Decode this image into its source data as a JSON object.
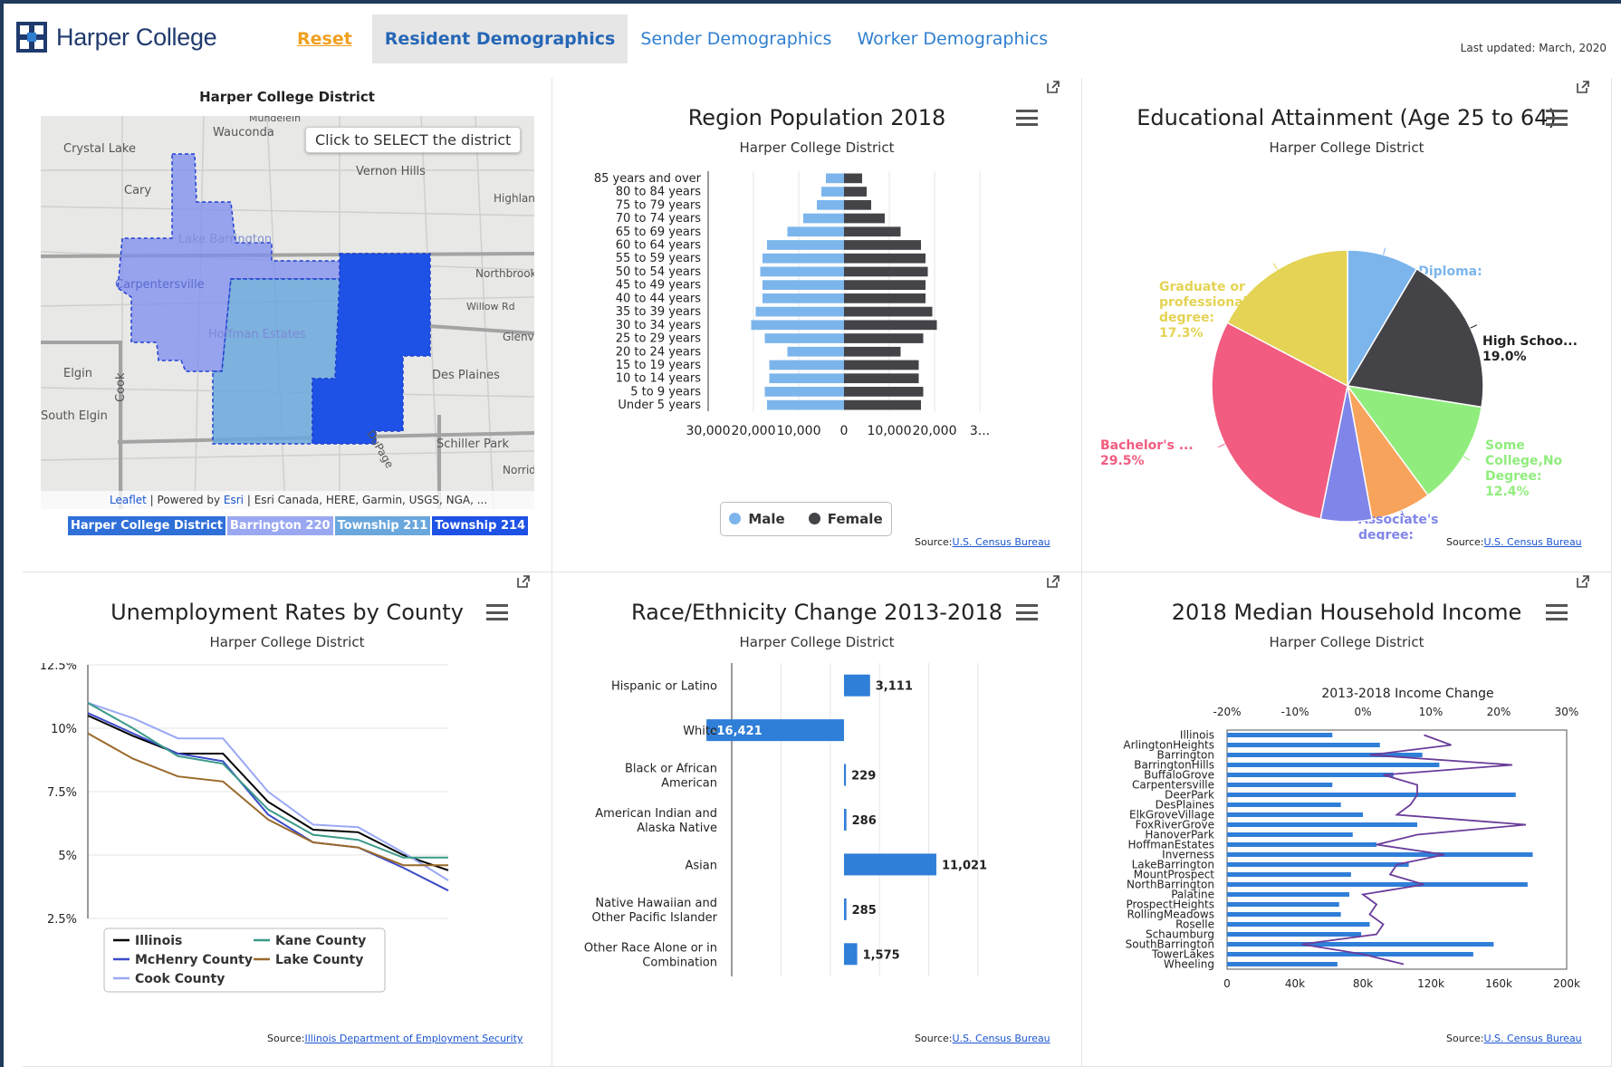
{
  "header": {
    "logo_text": "Harper College",
    "nav": {
      "reset": "Reset",
      "resident": "Resident Demographics",
      "sender": "Sender Demographics",
      "worker": "Worker Demographics"
    },
    "last_updated": "Last updated: March, 2020"
  },
  "map_panel": {
    "title": "Harper College District",
    "select_hint": "Click to SELECT the district",
    "place_labels": [
      "Wauconda",
      "Crystal Lake",
      "Vernon Hills",
      "Cary",
      "Highland Park",
      "Lake Barrington",
      "Carpentersville",
      "Northbrook",
      "Willow Rd",
      "Glenview",
      "Hoffman Estates",
      "Elgin",
      "Cook",
      "Des Plaines",
      "South Elgin",
      "Schiller Park",
      "DuPage",
      "Norridge",
      "Mundelein"
    ],
    "attribution": {
      "leaflet": "Leaflet",
      "powered": " | Powered by ",
      "esri": "Esri",
      "rest": " | Esri Canada, HERE, Garmin, USGS, NGA, ..."
    },
    "legend": [
      "Harper College District",
      "Barrington 220",
      "Township 211",
      "Township 214"
    ],
    "colors": {
      "district": "#7d8cf0",
      "barrington": "#9aa8f2",
      "township211": "#6aa7dc",
      "township214": "#1e52e6"
    }
  },
  "population_panel": {
    "title": "Region Population 2018",
    "subtitle": "Harper College District",
    "legend": {
      "male": "Male",
      "female": "Female"
    },
    "source_label": "Source:",
    "source_link": "U.S. Census Bureau"
  },
  "education_panel": {
    "title": "Educational Attainment (Age 25 to 64)",
    "subtitle": "Harper College District",
    "source_label": "Source:",
    "source_link": "U.S. Census Bureau"
  },
  "unemployment_panel": {
    "title": "Unemployment Rates by County",
    "subtitle": "Harper College District",
    "source_label": "Source:",
    "source_link": "Illinois Department of Employment Security"
  },
  "race_panel": {
    "title": "Race/Ethnicity Change 2013-2018",
    "subtitle": "Harper College District",
    "source_label": "Source:",
    "source_link": "U.S. Census Bureau"
  },
  "income_panel": {
    "title": "2018 Median Household Income",
    "subtitle": "Harper College District",
    "source_label": "Source:",
    "source_link": "U.S. Census Bureau"
  },
  "chart_data": [
    {
      "type": "bar",
      "id": "population",
      "orientation": "horizontal-pyramid",
      "categories": [
        "85 years and over",
        "80 to 84 years",
        "75 to 79 years",
        "70 to 74 years",
        "65 to 69 years",
        "60 to 64 years",
        "55 to 59 years",
        "50 to 54 years",
        "45 to 49 years",
        "40 to 44 years",
        "35 to 39 years",
        "30 to 34 years",
        "25 to 29 years",
        "20 to 24 years",
        "15 to 19 years",
        "10 to 14 years",
        "5 to 9 years",
        "Under 5 years"
      ],
      "series": [
        {
          "name": "Male",
          "color": "#7cb5ec",
          "values": [
            -4000,
            -5000,
            -6000,
            -9000,
            -12500,
            -17000,
            -18000,
            -18500,
            -18000,
            -18000,
            -19500,
            -20500,
            -17500,
            -12500,
            -16500,
            -16500,
            -17500,
            -17000
          ]
        },
        {
          "name": "Female",
          "color": "#434348",
          "values": [
            4000,
            5000,
            6000,
            9000,
            12500,
            17000,
            18000,
            18500,
            18000,
            18000,
            19500,
            20500,
            17500,
            12500,
            16500,
            16500,
            17500,
            17000
          ]
        }
      ],
      "xticks": [
        "30,000",
        "20,000",
        "10,000",
        "0",
        "10,000",
        "20,000",
        "3..."
      ],
      "xlim": [
        -30000,
        30000
      ]
    },
    {
      "type": "pie",
      "id": "education",
      "slices": [
        {
          "label": "No Diploma:",
          "value_label": "8.5%",
          "value": 8.5,
          "color": "#7cb5ec"
        },
        {
          "label": "High Schoo...",
          "value_label": "19.0%",
          "value": 19.0,
          "color": "#434348"
        },
        {
          "label": "Some College,No Degree:",
          "value_label": "12.4%",
          "value": 12.4,
          "color": "#90ed7d"
        },
        {
          "label": "Associate's degree:",
          "value_label": "7.2%",
          "value": 7.2,
          "color": "#f7a35c"
        },
        {
          "label": "",
          "value_label": "",
          "value": 6.1,
          "color": "#8085e9"
        },
        {
          "label": "Bachelor's ...",
          "value_label": "29.5%",
          "value": 29.5,
          "color": "#f15c80"
        },
        {
          "label": "Graduate or professional degree:",
          "value_label": "17.3%",
          "value": 17.3,
          "color": "#e4d354"
        }
      ]
    },
    {
      "type": "line",
      "id": "unemployment",
      "x": [
        0,
        1,
        2,
        3,
        4,
        5,
        6,
        7,
        8
      ],
      "ylim": [
        2.5,
        12.5
      ],
      "yticks": [
        "2.5%",
        "5%",
        "7.5%",
        "10%",
        "12.5%"
      ],
      "series": [
        {
          "name": "Illinois",
          "color": "#000000",
          "values": [
            10.5,
            9.7,
            9.0,
            9.0,
            7.1,
            6.0,
            5.9,
            5.0,
            4.4
          ]
        },
        {
          "name": "McHenry County",
          "color": "#3b4bc8",
          "values": [
            10.6,
            9.8,
            9.0,
            8.7,
            6.6,
            5.5,
            5.3,
            4.5,
            3.6
          ]
        },
        {
          "name": "Cook County",
          "color": "#9aa8f5",
          "values": [
            11.0,
            10.4,
            9.6,
            9.6,
            7.5,
            6.2,
            6.1,
            5.1,
            4.0
          ]
        },
        {
          "name": "Kane County",
          "color": "#3a9a8a",
          "values": [
            11.0,
            10.0,
            8.9,
            8.6,
            6.8,
            5.8,
            5.6,
            4.9,
            4.9
          ]
        },
        {
          "name": "Lake County",
          "color": "#9a6a2a",
          "values": [
            9.8,
            8.8,
            8.1,
            7.9,
            6.4,
            5.5,
            5.3,
            4.6,
            4.6
          ]
        }
      ]
    },
    {
      "type": "bar",
      "id": "race",
      "orientation": "horizontal",
      "categories": [
        [
          "Hispanic or Latino"
        ],
        [
          "White"
        ],
        [
          "Black or African",
          "American"
        ],
        [
          "American Indian and",
          "Alaska Native"
        ],
        [
          "Asian"
        ],
        [
          "Native Hawaiian and",
          "Other Pacific Islander"
        ],
        [
          "Other Race Alone or in",
          "Combination"
        ]
      ],
      "values": [
        3111,
        -16421,
        229,
        286,
        11021,
        285,
        1575
      ],
      "labels": [
        "3,111",
        "-16,421",
        "229",
        "286",
        "11,021",
        "285",
        "1,575"
      ],
      "color": "#2f7ed8",
      "xlim": [
        -20000,
        20000
      ]
    },
    {
      "type": "bar",
      "id": "income",
      "orientation": "horizontal",
      "title": "2013-2018 Income Change",
      "categories": [
        "Illinois",
        "ArlingtonHeights",
        "Barrington",
        "BarringtonHills",
        "BuffaloGrove",
        "Carpentersville",
        "DeerPark",
        "DesPlaines",
        "ElkGroveVillage",
        "FoxRiverGrove",
        "HanoverPark",
        "HoffmanEstates",
        "Inverness",
        "LakeBarrington",
        "MountProspect",
        "NorthBarrington",
        "Palatine",
        "ProspectHeights",
        "RollingMeadows",
        "Roselle",
        "Schaumburg",
        "SouthBarrington",
        "TowerLakes",
        "Wheeling"
      ],
      "values": [
        62000,
        90000,
        115000,
        125000,
        98000,
        62000,
        170000,
        67000,
        80000,
        112000,
        74000,
        88000,
        180000,
        107000,
        73000,
        177000,
        72000,
        66000,
        67000,
        84000,
        79000,
        157000,
        145000,
        65000
      ],
      "line_values": [
        9,
        13,
        1,
        22,
        3,
        8,
        8,
        7,
        5,
        24,
        8,
        2,
        12,
        5,
        4,
        9,
        0,
        2,
        1,
        3,
        2,
        -9,
        0,
        6
      ],
      "bar_color": "#2f7ed8",
      "line_color": "#6a3c9a",
      "xticks_bottom": [
        "0",
        "40k",
        "80k",
        "120k",
        "160k",
        "200k"
      ],
      "xlim_bottom": [
        0,
        200000
      ],
      "xticks_top": [
        "-20%",
        "-10%",
        "0%",
        "10%",
        "20%",
        "30%"
      ],
      "xlim_top": [
        -20,
        30
      ]
    }
  ]
}
